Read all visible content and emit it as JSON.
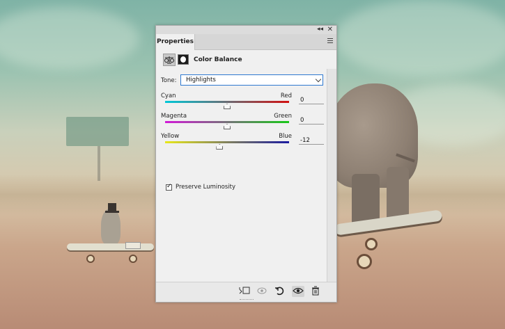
{
  "panel": {
    "tab_label": "Properties",
    "adjustment_title": "Color Balance",
    "tone": {
      "label": "Tone:",
      "selected": "Highlights"
    },
    "sliders": [
      {
        "left": "Cyan",
        "right": "Red",
        "value": "0",
        "position": 0.5,
        "gradient": [
          "#00c8d8",
          "#d21010"
        ]
      },
      {
        "left": "Magenta",
        "right": "Green",
        "value": "0",
        "position": 0.5,
        "gradient": [
          "#d21ad8",
          "#18c818"
        ]
      },
      {
        "left": "Yellow",
        "right": "Blue",
        "value": "-12",
        "position": 0.44,
        "gradient": [
          "#e8e81a",
          "#1a1aa0"
        ]
      }
    ],
    "preserve_luminosity": {
      "label": "Preserve Luminosity",
      "checked": true
    },
    "icons": {
      "collapse": "double-chevron-left-icon",
      "close": "close-icon",
      "menu": "panel-menu-icon",
      "adjustment": "balance-scale-icon",
      "mask": "layer-mask-icon",
      "clip": "clip-to-layer-icon",
      "view_previous": "view-previous-state-icon",
      "reset": "reset-icon",
      "visibility": "eye-icon",
      "delete": "trash-icon"
    }
  }
}
